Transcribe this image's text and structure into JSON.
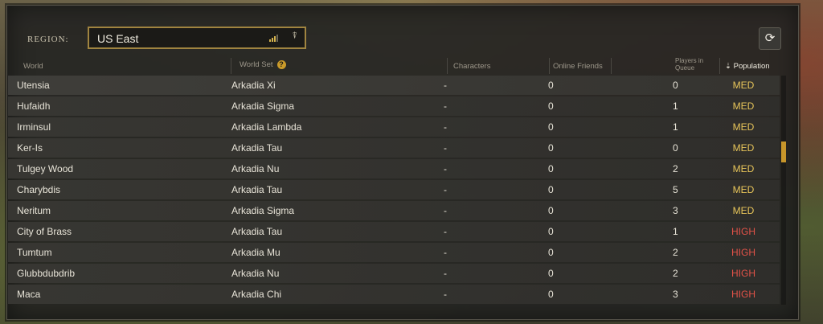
{
  "region": {
    "label": "REGION:",
    "selected": "US East",
    "signal_icon": "signal-bars-icon",
    "dropdown_icon": "ping-marker-icon"
  },
  "refresh_icon": "refresh-icon",
  "columns": {
    "world": "World",
    "world_set": "World Set",
    "help": "?",
    "characters": "Characters",
    "online_friends": "Online Friends",
    "players_in_queue_line1": "Players in",
    "players_in_queue_line2": "Queue",
    "population_sort": "⇣",
    "population": "Population"
  },
  "colors": {
    "accent": "#c8962a",
    "med": "#e8c55a",
    "high": "#e25248"
  },
  "worlds": [
    {
      "world": "Utensia",
      "set": "Arkadia Xi",
      "characters": "-",
      "friends": "0",
      "queue": "0",
      "population": "MED"
    },
    {
      "world": "Hufaidh",
      "set": "Arkadia Sigma",
      "characters": "-",
      "friends": "0",
      "queue": "1",
      "population": "MED"
    },
    {
      "world": "Irminsul",
      "set": "Arkadia Lambda",
      "characters": "-",
      "friends": "0",
      "queue": "1",
      "population": "MED"
    },
    {
      "world": "Ker-Is",
      "set": "Arkadia Tau",
      "characters": "-",
      "friends": "0",
      "queue": "0",
      "population": "MED"
    },
    {
      "world": "Tulgey Wood",
      "set": "Arkadia Nu",
      "characters": "-",
      "friends": "0",
      "queue": "2",
      "population": "MED"
    },
    {
      "world": "Charybdis",
      "set": "Arkadia Tau",
      "characters": "-",
      "friends": "0",
      "queue": "5",
      "population": "MED"
    },
    {
      "world": "Neritum",
      "set": "Arkadia Sigma",
      "characters": "-",
      "friends": "0",
      "queue": "3",
      "population": "MED"
    },
    {
      "world": "City of Brass",
      "set": "Arkadia Tau",
      "characters": "-",
      "friends": "0",
      "queue": "1",
      "population": "HIGH"
    },
    {
      "world": "Tumtum",
      "set": "Arkadia Mu",
      "characters": "-",
      "friends": "0",
      "queue": "2",
      "population": "HIGH"
    },
    {
      "world": "Glubbdubdrib",
      "set": "Arkadia Nu",
      "characters": "-",
      "friends": "0",
      "queue": "2",
      "population": "HIGH"
    },
    {
      "world": "Maca",
      "set": "Arkadia Chi",
      "characters": "-",
      "friends": "0",
      "queue": "3",
      "population": "HIGH"
    }
  ]
}
